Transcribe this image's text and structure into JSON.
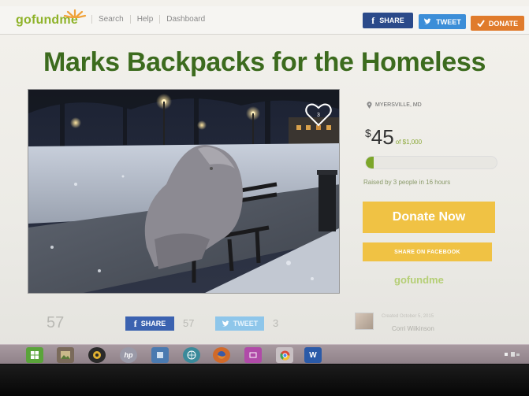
{
  "brand": {
    "logo_text": "gofundme",
    "accent": "#8fb32a"
  },
  "nav": {
    "links": [
      "Search",
      "Help",
      "Dashboard"
    ]
  },
  "header_buttons": {
    "share": "SHARE",
    "tweet": "TWEET",
    "donate": "DONATE",
    "share_color": "#2b4a8a",
    "tweet_color": "#3c8ed8",
    "donate_color": "#e07b2c"
  },
  "campaign": {
    "title": "Marks Backpacks for the Homeless",
    "favorite_count": "3",
    "location": "MYERSVILLE, MD",
    "raised_symbol": "$",
    "raised_amount": "45",
    "goal_text": "of $1,000",
    "progress_fraction": 0.045,
    "raised_note": "Raised by 3 people in 16 hours",
    "donate_now_label": "Donate Now",
    "share_facebook_label": "SHARE ON FACEBOOK"
  },
  "footer_stats": {
    "shares_count": "57",
    "share_label": "SHARE",
    "share_count_2": "57",
    "tweet_label": "TWEET",
    "tweet_count": "3",
    "created_text": "Created October 5, 2015",
    "creator_name": "Corri Wilkinson"
  },
  "taskbar": {
    "icons": [
      "windows-store-icon",
      "photos-icon",
      "media-icon",
      "hp-icon",
      "app-icon",
      "globe-icon",
      "firefox-icon",
      "network-icon",
      "chrome-icon",
      "word-icon"
    ]
  }
}
